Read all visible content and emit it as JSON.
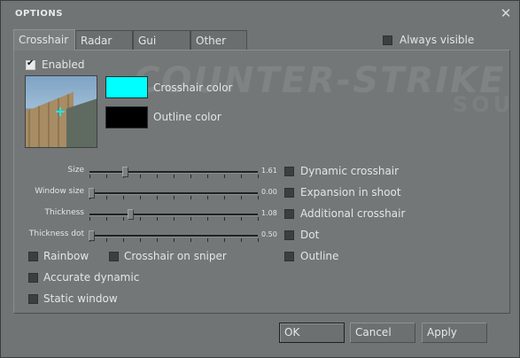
{
  "window": {
    "title": "OPTIONS",
    "close_glyph": "✕"
  },
  "tabs": [
    {
      "label": "Crosshair",
      "active": true
    },
    {
      "label": "Radar",
      "active": false
    },
    {
      "label": "Gui",
      "active": false
    },
    {
      "label": "Other",
      "active": false
    }
  ],
  "always_visible": {
    "label": "Always visible",
    "checked": false
  },
  "background_logo": {
    "text": "COUNTER-STRIKE",
    "sub": "SOU"
  },
  "enabled": {
    "label": "Enabled",
    "checked": true
  },
  "colors": {
    "crosshair": {
      "label": "Crosshair color",
      "value": "#00ffff"
    },
    "outline": {
      "label": "Outline color",
      "value": "#000000"
    }
  },
  "sliders": [
    {
      "label": "Size",
      "value": "1.61",
      "level": 0.2
    },
    {
      "label": "Window size",
      "value": "0.00",
      "level": 0.0
    },
    {
      "label": "Thickness",
      "value": "1.08",
      "level": 0.23
    },
    {
      "label": "Thickness dot",
      "value": "0.50",
      "level": 0.0
    }
  ],
  "right_options": [
    {
      "label": "Dynamic crosshair",
      "checked": false
    },
    {
      "label": "Expansion in shoot",
      "checked": false
    },
    {
      "label": "Additional crosshair",
      "checked": false
    },
    {
      "label": "Dot",
      "checked": false
    },
    {
      "label": "Outline",
      "checked": false
    }
  ],
  "left_options": [
    {
      "label": "Rainbow",
      "checked": false
    },
    {
      "label": "Crosshair on sniper",
      "checked": false
    },
    {
      "label": "Accurate dynamic",
      "checked": false
    },
    {
      "label": "Static window",
      "checked": false
    }
  ],
  "buttons": {
    "ok": "OK",
    "cancel": "Cancel",
    "apply": "Apply"
  }
}
